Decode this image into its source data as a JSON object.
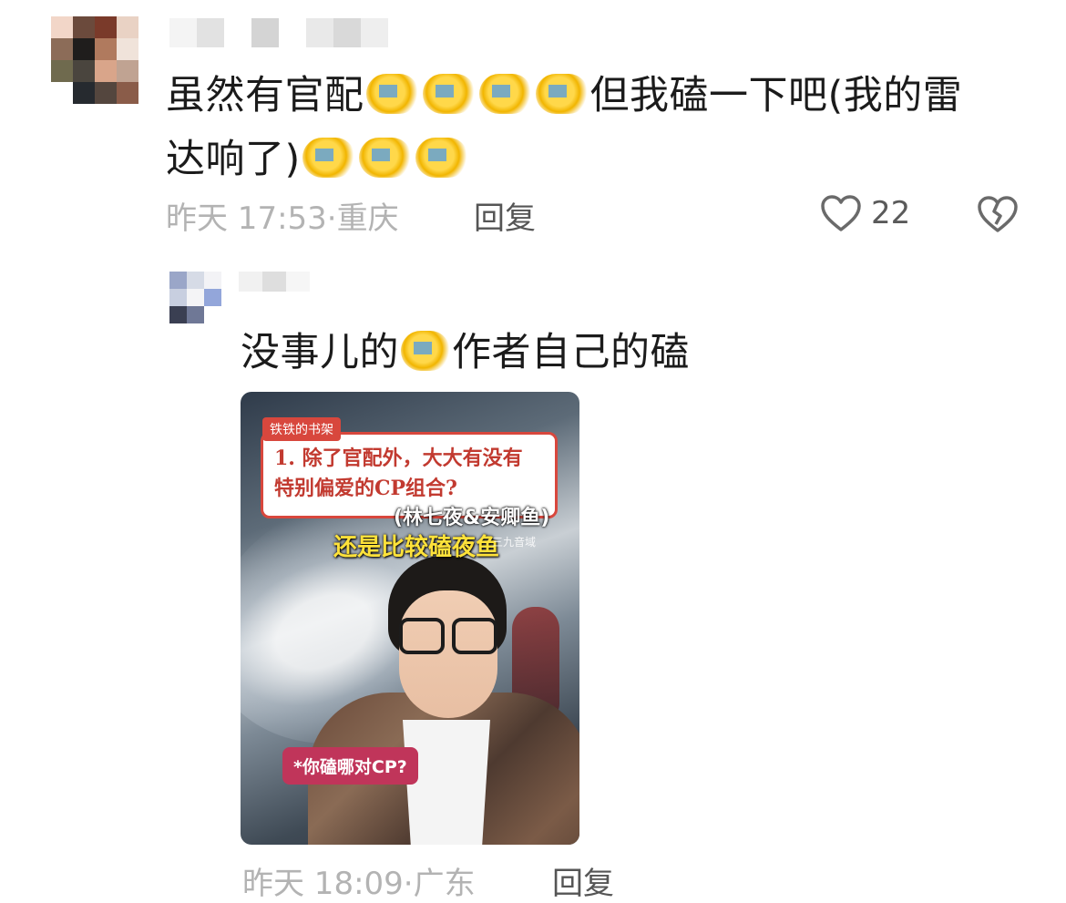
{
  "comments": [
    {
      "text_a": "虽然有官配",
      "text_b": "但我磕一下吧(我的雷",
      "text_c": "达响了)",
      "time": "昨天 17:53·",
      "location": "重庆",
      "reply_label": "回复",
      "like_count": "22",
      "icons": [
        "heart-icon",
        "broken-heart-icon"
      ]
    }
  ],
  "reply": {
    "text_a": "没事儿的",
    "text_b": "作者自己的磕",
    "time": "昨天 18:09·",
    "location": "广东",
    "reply_label": "回复",
    "video": {
      "tag": "铁铁的书架",
      "question_line1": "1. 除了官配外，大大有没有",
      "question_line2": "特别偏爱的CP组合?",
      "names": "(林七夜&安卿鱼)",
      "caption": "还是比较磕夜鱼",
      "watermark": "三九音域",
      "ask_label": "*你磕哪对CP?"
    }
  },
  "colors": {
    "meta_gray": "#b3b3b3",
    "text": "#1b1b1b",
    "accent_red": "#d8473d"
  }
}
